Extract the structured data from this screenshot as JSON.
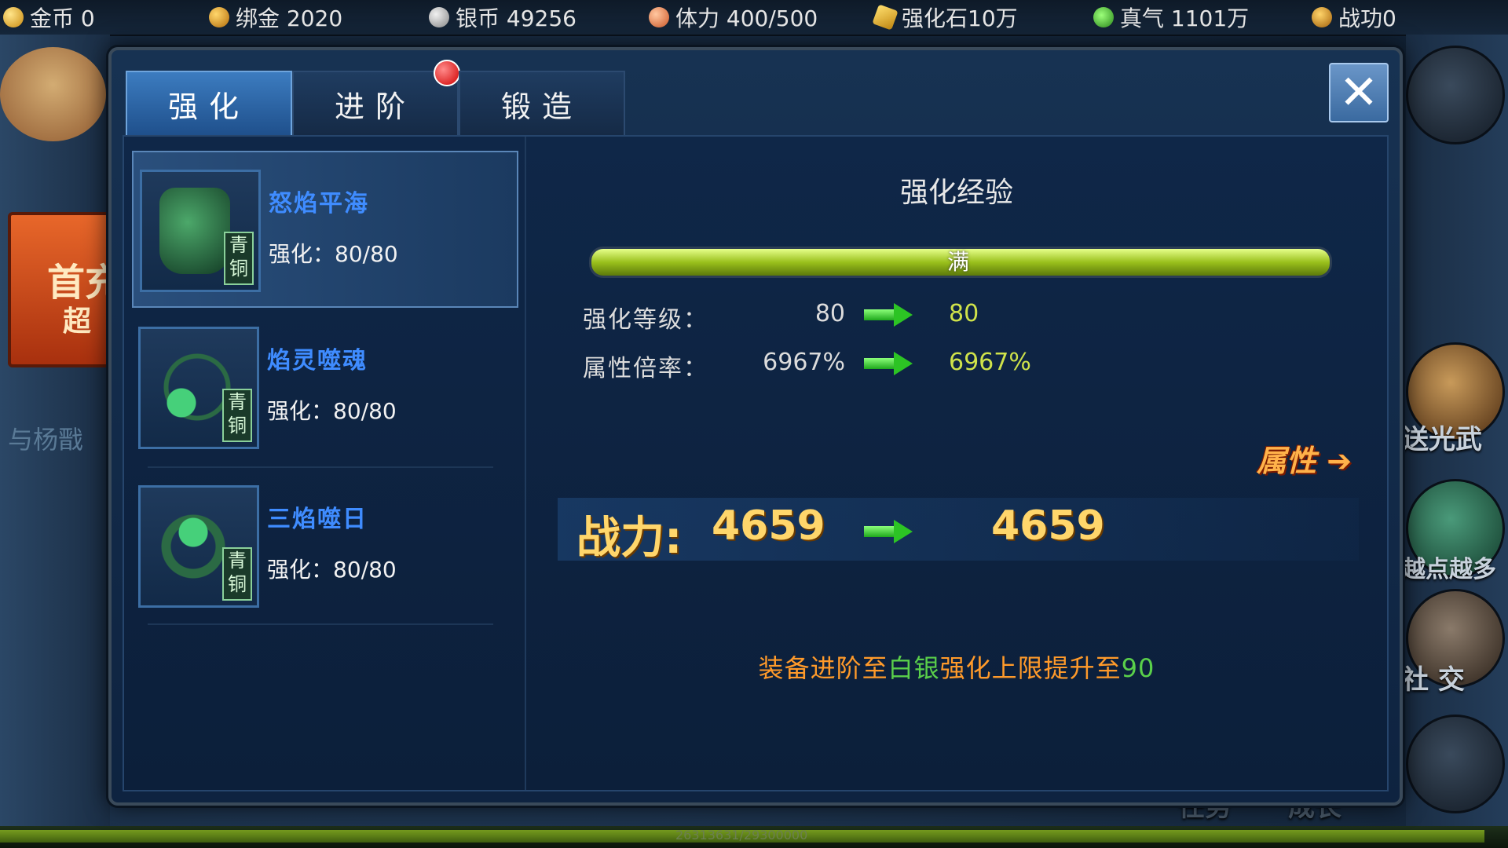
{
  "resources": [
    {
      "icon": "gold-coin-icon",
      "label": "金币 0"
    },
    {
      "icon": "bound-gold-icon",
      "label": "绑金 2020"
    },
    {
      "icon": "silver-coin-icon",
      "label": "银币 49256"
    },
    {
      "icon": "stamina-icon",
      "label": "体力 400/500"
    },
    {
      "icon": "enhance-stone-icon",
      "label": "强化石10万"
    },
    {
      "icon": "qi-icon",
      "label": "真气 1101万"
    },
    {
      "icon": "merit-icon",
      "label": "战功0"
    }
  ],
  "background": {
    "banner_text": "首充",
    "banner_sub": "超",
    "left_sub": "与杨戬",
    "right_buttons": [
      "送光武",
      "越点越多",
      "社 交"
    ],
    "bottom_exp": "26313631/29300000",
    "bottom_labels": [
      "任务",
      "成长"
    ]
  },
  "tabs": [
    {
      "label": "强化",
      "active": true
    },
    {
      "label": "进阶",
      "active": false,
      "notification": true
    },
    {
      "label": "锻造",
      "active": false
    }
  ],
  "close_label": "✕",
  "equipment": [
    {
      "name": "怒焰平海",
      "level_text": "强化：80/80",
      "grade": "青铜",
      "type": "boots",
      "selected": true
    },
    {
      "name": "焰灵噬魂",
      "level_text": "强化：80/80",
      "grade": "青铜",
      "type": "necklace",
      "selected": false
    },
    {
      "name": "三焰噬日",
      "level_text": "强化：80/80",
      "grade": "青铜",
      "type": "ring",
      "selected": false
    }
  ],
  "detail": {
    "exp_title": "强化经验",
    "exp_bar_label": "满",
    "exp_fill_ratio": 1.0,
    "stats": [
      {
        "label": "强化等级：",
        "current": "80",
        "next": "80"
      },
      {
        "label": "属性倍率：",
        "current": "6967%",
        "next": "6967%"
      }
    ],
    "attr_button": "属性",
    "power_label": "战力:",
    "power_current": "4659",
    "power_next": "4659",
    "hint_part1": "装备进阶至",
    "hint_part2": "白银",
    "hint_part3": "强化上限提升至",
    "hint_part4": "90"
  },
  "colors": {
    "accent_gold": "#ffd66b",
    "item_name_blue": "#3f8cff",
    "hint_orange": "#ff9a2a",
    "hint_green": "#5ad04a",
    "exp_bar_green": "#9ac01c"
  }
}
